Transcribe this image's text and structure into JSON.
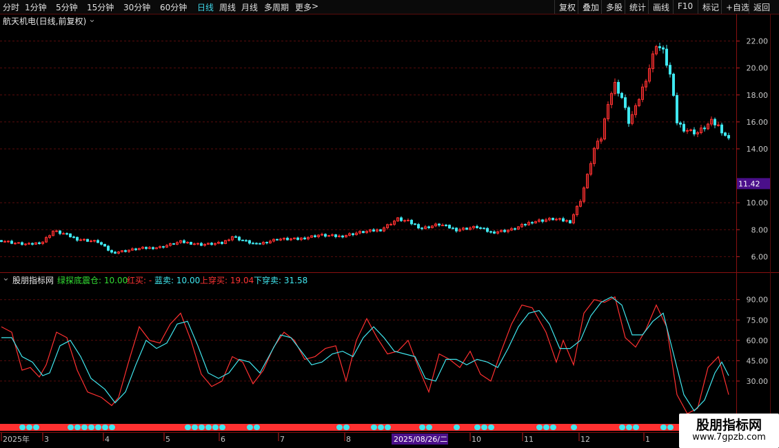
{
  "toolbar": {
    "periods": [
      "分时",
      "1分钟",
      "5分钟",
      "15分钟",
      "30分钟",
      "60分钟",
      "日线",
      "周线",
      "月线",
      "多周期",
      "更多"
    ],
    "active_index": 6,
    "more_arrow": ">",
    "right": [
      "复权",
      "叠加",
      "多股",
      "统计",
      "画线",
      "F10",
      "标记",
      "+自选",
      "返回"
    ]
  },
  "main_chart": {
    "title": "航天机电(日线,前复权)",
    "current_price": "11.42"
  },
  "indicator": {
    "name": "股朋指标网",
    "labels": [
      {
        "text": "绿探底震仓: 10.00",
        "color": "#33dd33"
      },
      {
        "text": "红买: -",
        "color": "#ff3333"
      },
      {
        "text": "蓝卖: 10.00",
        "color": "#40e8f0"
      },
      {
        "text": "上穿买: 19.04",
        "color": "#ff3333"
      },
      {
        "text": "下穿卖: 31.58",
        "color": "#40e8f0"
      }
    ]
  },
  "time_axis": {
    "labels": [
      "2025年",
      "3",
      "4",
      "5",
      "6",
      "7",
      "8",
      "10",
      "11",
      "12",
      "1"
    ],
    "highlight": "2025/08/26/二"
  },
  "watermark": {
    "line1": "股朋指标网",
    "line2": "www.7gpzb.com"
  },
  "colors": {
    "up": "#ff3030",
    "down": "#3fe8f0",
    "grid": "#5a0c0c",
    "price_tag_bg": "#4a0f8a"
  },
  "chart_data": [
    {
      "type": "candlestick",
      "title": "航天机电(日线,前复权)",
      "y_ticks": [
        "22.00",
        "20.00",
        "18.00",
        "16.00",
        "14.00",
        "10.00",
        "8.00",
        "6.00"
      ],
      "ylim": [
        5.2,
        23.0
      ],
      "close_anchors": [
        [
          0,
          7.2
        ],
        [
          20,
          7.0
        ],
        [
          40,
          6.9
        ],
        [
          60,
          7.1
        ],
        [
          75,
          7.9
        ],
        [
          90,
          7.7
        ],
        [
          110,
          7.3
        ],
        [
          140,
          7.1
        ],
        [
          160,
          6.3
        ],
        [
          175,
          6.4
        ],
        [
          200,
          6.6
        ],
        [
          230,
          6.7
        ],
        [
          260,
          7.1
        ],
        [
          290,
          6.9
        ],
        [
          320,
          7.0
        ],
        [
          335,
          7.5
        ],
        [
          350,
          7.2
        ],
        [
          370,
          6.9
        ],
        [
          400,
          7.3
        ],
        [
          430,
          7.3
        ],
        [
          460,
          7.6
        ],
        [
          490,
          7.5
        ],
        [
          520,
          7.8
        ],
        [
          550,
          8.0
        ],
        [
          575,
          8.8
        ],
        [
          590,
          8.6
        ],
        [
          610,
          8.1
        ],
        [
          635,
          8.4
        ],
        [
          660,
          8.0
        ],
        [
          690,
          8.2
        ],
        [
          710,
          7.8
        ],
        [
          740,
          8.0
        ],
        [
          770,
          8.6
        ],
        [
          800,
          8.8
        ],
        [
          825,
          8.6
        ],
        [
          840,
          10.2
        ],
        [
          850,
          12.0
        ],
        [
          860,
          14.0
        ],
        [
          870,
          14.8
        ],
        [
          880,
          17.5
        ],
        [
          890,
          18.8
        ],
        [
          900,
          17.8
        ],
        [
          910,
          16.0
        ],
        [
          920,
          17.0
        ],
        [
          930,
          18.5
        ],
        [
          940,
          20.0
        ],
        [
          950,
          21.8
        ],
        [
          960,
          21.2
        ],
        [
          970,
          19.5
        ],
        [
          980,
          16.0
        ],
        [
          990,
          15.5
        ],
        [
          1000,
          15.3
        ],
        [
          1010,
          15.2
        ],
        [
          1020,
          15.6
        ],
        [
          1030,
          16.0
        ],
        [
          1040,
          15.7
        ],
        [
          1055,
          14.7
        ]
      ]
    },
    {
      "type": "line",
      "series": [
        {
          "name": "红",
          "color": "#ff3030",
          "points": [
            [
              0,
              70
            ],
            [
              15,
              66
            ],
            [
              30,
              38
            ],
            [
              42,
              40
            ],
            [
              55,
              33
            ],
            [
              65,
              42
            ],
            [
              80,
              66
            ],
            [
              95,
              62
            ],
            [
              110,
              38
            ],
            [
              125,
              22
            ],
            [
              145,
              18
            ],
            [
              160,
              12
            ],
            [
              170,
              18
            ],
            [
              185,
              45
            ],
            [
              200,
              70
            ],
            [
              215,
              60
            ],
            [
              230,
              58
            ],
            [
              245,
              72
            ],
            [
              260,
              80
            ],
            [
              275,
              60
            ],
            [
              290,
              35
            ],
            [
              305,
              26
            ],
            [
              320,
              30
            ],
            [
              335,
              48
            ],
            [
              350,
              44
            ],
            [
              365,
              28
            ],
            [
              380,
              38
            ],
            [
              395,
              55
            ],
            [
              410,
              66
            ],
            [
              425,
              60
            ],
            [
              440,
              46
            ],
            [
              455,
              48
            ],
            [
              470,
              54
            ],
            [
              485,
              56
            ],
            [
              500,
              30
            ],
            [
              515,
              60
            ],
            [
              530,
              76
            ],
            [
              545,
              62
            ],
            [
              560,
              50
            ],
            [
              575,
              52
            ],
            [
              590,
              60
            ],
            [
              605,
              40
            ],
            [
              620,
              22
            ],
            [
              635,
              50
            ],
            [
              650,
              46
            ],
            [
              665,
              40
            ],
            [
              680,
              52
            ],
            [
              695,
              35
            ],
            [
              710,
              30
            ],
            [
              725,
              52
            ],
            [
              740,
              72
            ],
            [
              755,
              86
            ],
            [
              770,
              84
            ],
            [
              790,
              66
            ],
            [
              805,
              44
            ],
            [
              815,
              60
            ],
            [
              830,
              42
            ],
            [
              845,
              80
            ],
            [
              860,
              90
            ],
            [
              875,
              88
            ],
            [
              890,
              92
            ],
            [
              905,
              62
            ],
            [
              920,
              55
            ],
            [
              935,
              68
            ],
            [
              950,
              86
            ],
            [
              965,
              70
            ],
            [
              980,
              20
            ],
            [
              995,
              6
            ],
            [
              1010,
              10
            ],
            [
              1025,
              40
            ],
            [
              1040,
              48
            ],
            [
              1055,
              20
            ]
          ]
        },
        {
          "name": "蓝",
          "color": "#40e8f0",
          "points": [
            [
              0,
              62
            ],
            [
              15,
              62
            ],
            [
              30,
              48
            ],
            [
              45,
              44
            ],
            [
              60,
              34
            ],
            [
              70,
              36
            ],
            [
              85,
              56
            ],
            [
              100,
              60
            ],
            [
              115,
              48
            ],
            [
              130,
              32
            ],
            [
              150,
              24
            ],
            [
              165,
              14
            ],
            [
              180,
              22
            ],
            [
              195,
              42
            ],
            [
              210,
              60
            ],
            [
              225,
              54
            ],
            [
              240,
              58
            ],
            [
              255,
              72
            ],
            [
              270,
              74
            ],
            [
              285,
              56
            ],
            [
              300,
              36
            ],
            [
              315,
              32
            ],
            [
              330,
              36
            ],
            [
              345,
              46
            ],
            [
              360,
              44
            ],
            [
              375,
              36
            ],
            [
              390,
              50
            ],
            [
              405,
              64
            ],
            [
              420,
              62
            ],
            [
              435,
              52
            ],
            [
              450,
              42
            ],
            [
              465,
              44
            ],
            [
              480,
              50
            ],
            [
              495,
              52
            ],
            [
              510,
              48
            ],
            [
              525,
              62
            ],
            [
              540,
              70
            ],
            [
              555,
              62
            ],
            [
              570,
              52
            ],
            [
              585,
              50
            ],
            [
              600,
              48
            ],
            [
              615,
              32
            ],
            [
              630,
              30
            ],
            [
              645,
              46
            ],
            [
              660,
              46
            ],
            [
              675,
              42
            ],
            [
              690,
              46
            ],
            [
              705,
              44
            ],
            [
              720,
              40
            ],
            [
              735,
              54
            ],
            [
              750,
              70
            ],
            [
              765,
              80
            ],
            [
              780,
              82
            ],
            [
              795,
              72
            ],
            [
              810,
              54
            ],
            [
              825,
              54
            ],
            [
              840,
              60
            ],
            [
              855,
              78
            ],
            [
              870,
              88
            ],
            [
              885,
              92
            ],
            [
              900,
              86
            ],
            [
              915,
              64
            ],
            [
              930,
              64
            ],
            [
              945,
              74
            ],
            [
              960,
              80
            ],
            [
              975,
              50
            ],
            [
              990,
              20
            ],
            [
              1005,
              8
            ],
            [
              1020,
              16
            ],
            [
              1035,
              36
            ],
            [
              1045,
              44
            ],
            [
              1055,
              34
            ]
          ]
        }
      ],
      "y_ticks": [
        "90.00",
        "75.00",
        "60.00",
        "45.00",
        "30.00"
      ],
      "ylim": [
        0,
        100
      ]
    }
  ]
}
